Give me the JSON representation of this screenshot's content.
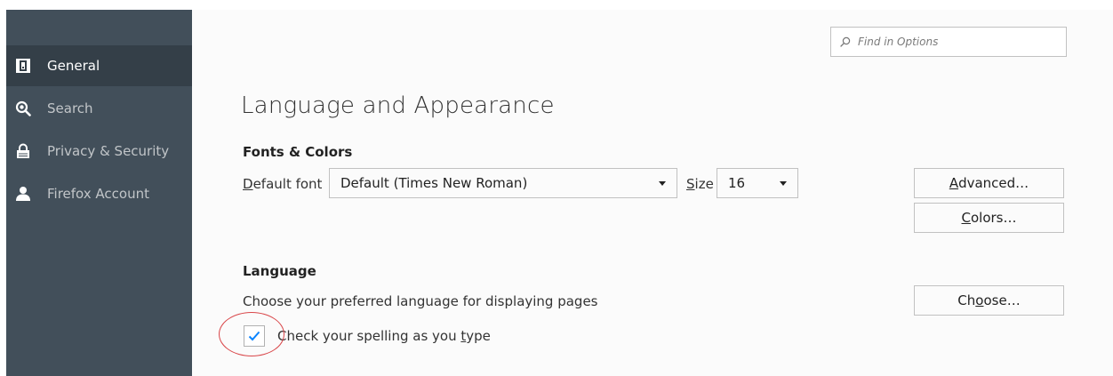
{
  "sidebar": {
    "items": [
      {
        "label": "General",
        "icon": "general-icon",
        "selected": true
      },
      {
        "label": "Search",
        "icon": "search-icon",
        "selected": false
      },
      {
        "label": "Privacy & Security",
        "icon": "lock-icon",
        "selected": false
      },
      {
        "label": "Firefox Account",
        "icon": "account-icon",
        "selected": false
      }
    ]
  },
  "search": {
    "placeholder": "Find in Options",
    "value": ""
  },
  "page": {
    "title": "Language and Appearance"
  },
  "fonts_colors": {
    "heading": "Fonts & Colors",
    "default_font_label": "Default font",
    "default_font_label_access": "D",
    "default_font_label_rest": "efault font",
    "default_font_value": "Default (Times New Roman)",
    "size_label_access": "S",
    "size_label_rest": "ize",
    "size_value": "16",
    "advanced_access": "A",
    "advanced_rest": "dvanced…",
    "colors_access": "C",
    "colors_rest": "olors…"
  },
  "language": {
    "heading": "Language",
    "choose_text": "Choose your preferred language for displaying pages",
    "choose_pre": "Ch",
    "choose_access": "o",
    "choose_rest": "ose…",
    "spell_pre": "Check your spelling as you ",
    "spell_access": "t",
    "spell_rest": "ype",
    "spell_checked": true
  },
  "colors": {
    "sidebar_bg": "#424f5a",
    "sidebar_selected": "#343f48",
    "content_bg": "#fbfbfb",
    "checkmark": "#0a84ff",
    "annotation": "#d9474a"
  }
}
